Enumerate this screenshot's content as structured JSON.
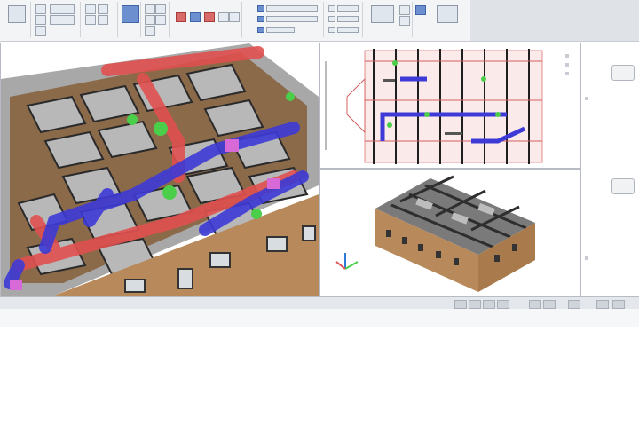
{
  "ribbon": {
    "groups": [
      "",
      "",
      "",
      "",
      "",
      "",
      "",
      "",
      ""
    ]
  },
  "viewports": {
    "left_3d": {
      "label": ""
    },
    "top_plan": {
      "label": ""
    },
    "iso_model": {
      "label": ""
    }
  },
  "command_line": {
    "text": ""
  },
  "status_bar": {
    "items": []
  },
  "colors": {
    "wall": "#b8895a",
    "duct_supply": "#e0504f",
    "duct_return": "#3d3ad6",
    "fitting": "#4bcf4b",
    "box": "#d86ad8"
  }
}
